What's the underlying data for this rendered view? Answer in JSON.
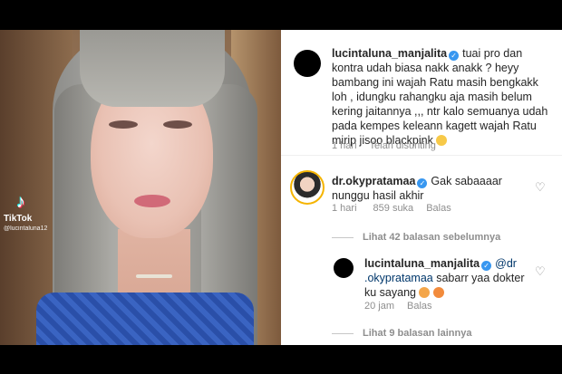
{
  "video": {
    "brand": "TikTok",
    "handle": "@lucintaluna12"
  },
  "comments": [
    {
      "user": "lucintaluna_manjalita",
      "lines": [
        "tuai pro dan",
        "kontra udah biasa nakk anakk ? heyy",
        "bambang ini wajah Ratu masih bengkakk",
        "loh , idungku rahangku aja masih belum",
        "kering jaitannya ,,, ntr kalo semuanya udah",
        "pada kempes keleann kagett wajah Ratu",
        "mirip jisoo blackpink"
      ],
      "time": "1 hari",
      "pinned": "Telah disunting"
    },
    {
      "user": "dr.okypratamaa",
      "lines": [
        "Gak sabaaaar",
        "nunggu hasil akhir"
      ],
      "time": "1 hari",
      "likes": "859 suka",
      "reply": "Balas"
    }
  ],
  "view_prev_replies": "Lihat 42 balasan sebelumnya",
  "reply": {
    "user": "lucintaluna_manjalita",
    "mention_a": "@dr",
    "mention_b": ".okypratamaa",
    "rest_a": " sabarr yaa dokter",
    "rest_b": "ku sayang",
    "time": "20 jam",
    "reply": "Balas"
  },
  "view_more_replies": "Lihat 9 balasan lainnya",
  "colors": {
    "verified": "#3897f0",
    "meta": "#8e8e8e",
    "text": "#262626"
  },
  "icons": [
    "tiktok-icon",
    "verified-icon",
    "heart-icon",
    "emoji-icon"
  ]
}
